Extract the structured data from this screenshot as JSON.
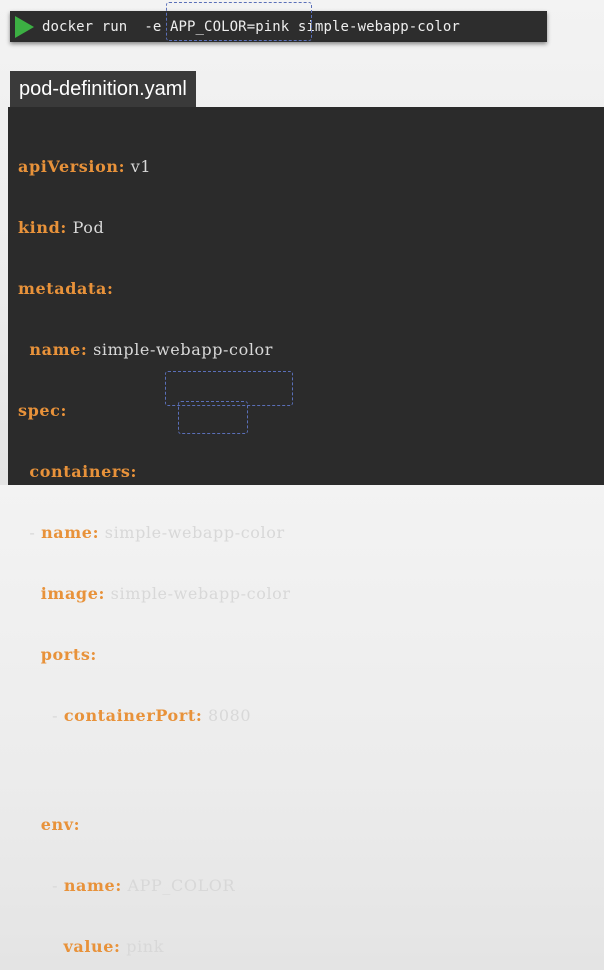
{
  "command": {
    "prefix": "docker run  -e ",
    "env_var": "APP_COLOR=pink",
    "image": " simple-webapp-color"
  },
  "file": {
    "name": "pod-definition.yaml"
  },
  "yaml": {
    "apiVersion_key": "apiVersion:",
    "apiVersion_val": " v1",
    "kind_key": "kind:",
    "kind_val": " Pod",
    "metadata_key": "metadata:",
    "meta_name_key": "name:",
    "meta_name_val": " simple-webapp-color",
    "spec_key": "spec:",
    "containers_key": "containers:",
    "dash": "- ",
    "c_name_key": "name:",
    "c_name_val": " simple-webapp-color",
    "image_key": "image:",
    "image_val": " simple-webapp-color",
    "ports_key": "ports:",
    "cport_key": "containerPort:",
    "cport_val": " 8080",
    "env_key": "env:",
    "env_name_key": "name:",
    "env_name_val": " APP_COLOR",
    "env_value_key": "value:",
    "env_value_val": " pink"
  },
  "colors": {
    "key": "#e8923a",
    "highlight_border": "#5a6fb8",
    "play": "#3cb043"
  }
}
